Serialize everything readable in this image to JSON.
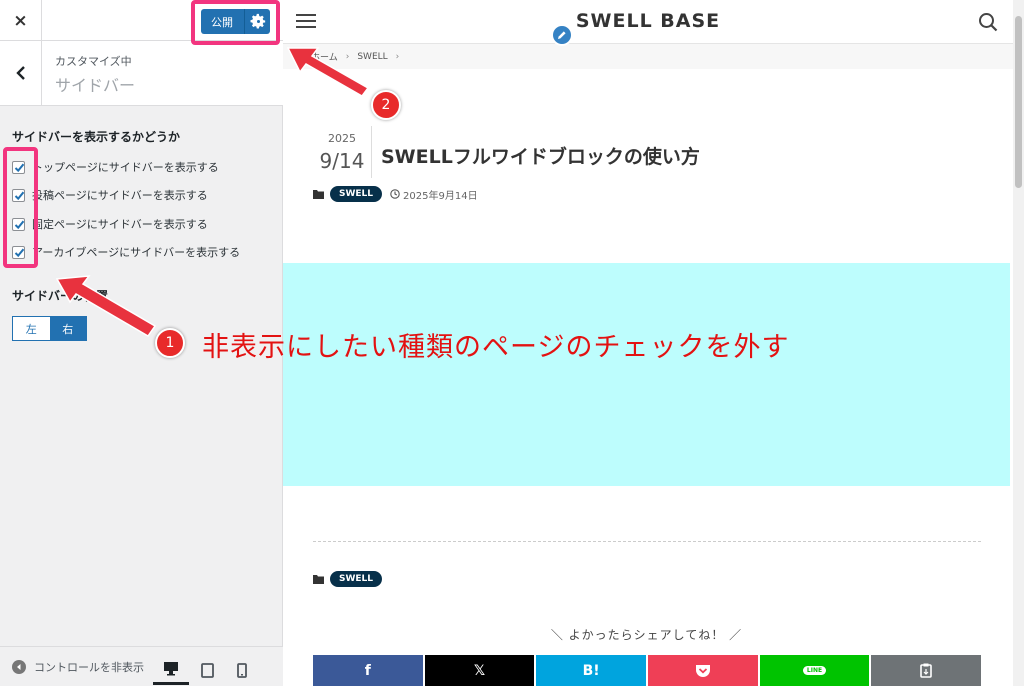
{
  "panel": {
    "close_label": "×",
    "publish_label": "公開",
    "section_small": "カスタマイズ中",
    "section_title": "サイドバー",
    "option_title": "サイドバーを表示するかどうか",
    "checkboxes": [
      {
        "label": "トップページにサイドバーを表示する",
        "checked": true
      },
      {
        "label": "投稿ページにサイドバーを表示する",
        "checked": true
      },
      {
        "label": "固定ページにサイドバーを表示する",
        "checked": true
      },
      {
        "label": "アーカイブページにサイドバーを表示する",
        "checked": true
      }
    ],
    "position_title": "サイドバーの位置",
    "position_options": {
      "left": "左",
      "right": "右",
      "selected": "右"
    },
    "hide_controls_label": "コントロールを非表示",
    "accent_color": "#2271b1"
  },
  "site": {
    "title": "SWELL BASE",
    "breadcrumb": [
      "ホーム",
      "SWELL"
    ],
    "post": {
      "year": "2025",
      "month_day": "9/14",
      "title": "SWELLフルワイドブロックの使い方",
      "category": "SWELL",
      "date": "2025年9月14日"
    },
    "fullwide_color": "#bdfdfd",
    "share_title": "＼ よかったらシェアしてね！ ／",
    "share_buttons": [
      {
        "icon": "facebook-icon",
        "label": "f",
        "color": "#3b5998"
      },
      {
        "icon": "x-icon",
        "label": "𝕏",
        "color": "#000000"
      },
      {
        "icon": "hatena-icon",
        "label": "B!",
        "color": "#00a4de"
      },
      {
        "icon": "pocket-icon",
        "label": "",
        "color": "#ef3f56"
      },
      {
        "icon": "line-icon",
        "label": "LINE",
        "color": "#00c300"
      },
      {
        "icon": "copy-icon",
        "label": "",
        "color": "#6e7376"
      }
    ]
  },
  "annotations": {
    "badge1": "1",
    "badge2": "2",
    "note": "非表示にしたい種類のページのチェックを外す",
    "highlight_color": "#f2357f"
  }
}
